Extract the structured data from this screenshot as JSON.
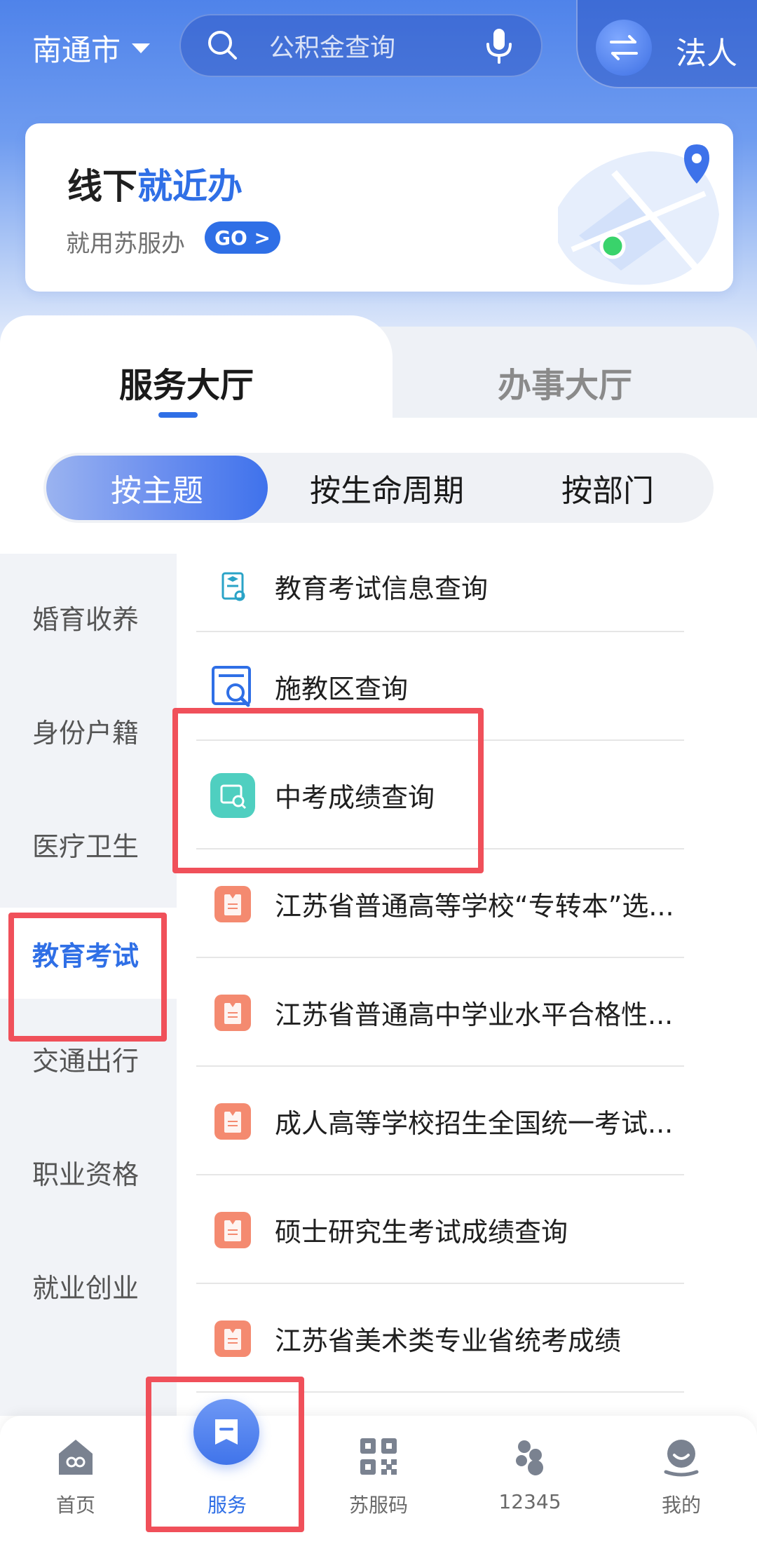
{
  "header": {
    "city": "南通市",
    "search_placeholder": "公积金查询",
    "switch_label": "法人"
  },
  "banner": {
    "title_plain": "线下",
    "title_highlight": "就近办",
    "subtitle": "就用苏服办",
    "go_label": "GO >"
  },
  "tabs": {
    "active": "服务大厅",
    "inactive": "办事大厅"
  },
  "segments": [
    "按主题",
    "按生命周期",
    "按部门"
  ],
  "sidebar": {
    "items": [
      "婚育收养",
      "身份户籍",
      "医疗卫生",
      "教育考试",
      "交通出行",
      "职业资格",
      "就业创业"
    ],
    "active_index": 3
  },
  "list": {
    "items": [
      "教育考试信息查询",
      "施教区查询",
      "中考成绩查询",
      "江苏省普通高等学校“专转本”选...",
      "江苏省普通高中学业水平合格性...",
      "成人高等学校招生全国统一考试...",
      "硕士研究生考试成绩查询",
      "江苏省美术类专业省统考成绩"
    ]
  },
  "bottom_nav": {
    "items": [
      "首页",
      "服务",
      "苏服码",
      "12345",
      "我的"
    ],
    "active_index": 1
  },
  "colors": {
    "primary": "#2f6fe6",
    "highlight_box": "#f0505a",
    "icon_orange": "#f48a70",
    "icon_teal": "#4fcfc0"
  }
}
